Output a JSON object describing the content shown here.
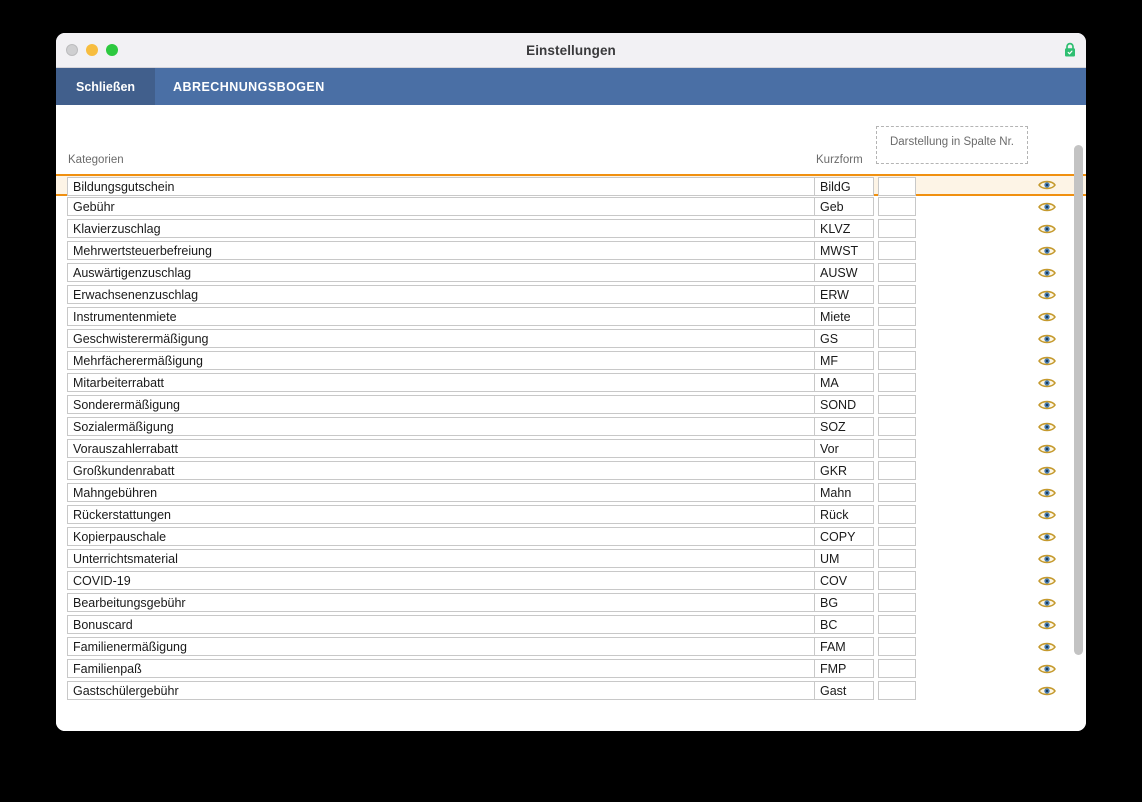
{
  "window": {
    "title": "Einstellungen",
    "traffic_lights": {
      "close": "close-button",
      "minimize": "minimize-button",
      "maximize": "maximize-button"
    },
    "lock_icon": "lock-icon",
    "lock_color": "#2fbf71"
  },
  "toolbar": {
    "close_label": "Schließen",
    "tab_label": "ABRECHNUNGSBOGEN",
    "background": "#4a6fa5",
    "close_background": "#415f8c"
  },
  "headers": {
    "kategorien": "Kategorien",
    "kurzform": "Kurzform",
    "spalte_group": "Darstellung in Spalte Nr."
  },
  "selection": {
    "selected_index": 0,
    "highlight_color": "#f09010",
    "highlight_background": "#fdf4e6"
  },
  "icons": {
    "eye": "eye-icon",
    "eye_outline_color": "#c59a2e",
    "eye_iris_color": "#4a7fb5"
  },
  "rows": [
    {
      "kategorie": "Bildungsgutschein",
      "kurzform": "BildG",
      "spalte": ""
    },
    {
      "kategorie": "Gebühr",
      "kurzform": "Geb",
      "spalte": ""
    },
    {
      "kategorie": "Klavierzuschlag",
      "kurzform": "KLVZ",
      "spalte": ""
    },
    {
      "kategorie": "Mehrwertsteuerbefreiung",
      "kurzform": "MWST",
      "spalte": ""
    },
    {
      "kategorie": "Auswärtigenzuschlag",
      "kurzform": "AUSW",
      "spalte": ""
    },
    {
      "kategorie": "Erwachsenenzuschlag",
      "kurzform": "ERW",
      "spalte": ""
    },
    {
      "kategorie": "Instrumentenmiete",
      "kurzform": "Miete",
      "spalte": ""
    },
    {
      "kategorie": "Geschwisterermäßigung",
      "kurzform": "GS",
      "spalte": ""
    },
    {
      "kategorie": "Mehrfächerermäßigung",
      "kurzform": "MF",
      "spalte": ""
    },
    {
      "kategorie": "Mitarbeiterrabatt",
      "kurzform": "MA",
      "spalte": ""
    },
    {
      "kategorie": "Sonderermäßigung",
      "kurzform": "SOND",
      "spalte": ""
    },
    {
      "kategorie": "Sozialermäßigung",
      "kurzform": "SOZ",
      "spalte": ""
    },
    {
      "kategorie": "Vorauszahlerrabatt",
      "kurzform": "Vor",
      "spalte": ""
    },
    {
      "kategorie": "Großkundenrabatt",
      "kurzform": "GKR",
      "spalte": ""
    },
    {
      "kategorie": "Mahngebühren",
      "kurzform": "Mahn",
      "spalte": ""
    },
    {
      "kategorie": "Rückerstattungen",
      "kurzform": "Rück",
      "spalte": ""
    },
    {
      "kategorie": "Kopierpauschale",
      "kurzform": "COPY",
      "spalte": ""
    },
    {
      "kategorie": "Unterrichtsmaterial",
      "kurzform": "UM",
      "spalte": ""
    },
    {
      "kategorie": "COVID-19",
      "kurzform": "COV",
      "spalte": ""
    },
    {
      "kategorie": "Bearbeitungsgebühr",
      "kurzform": "BG",
      "spalte": ""
    },
    {
      "kategorie": "Bonuscard",
      "kurzform": "BC",
      "spalte": ""
    },
    {
      "kategorie": "Familienermäßigung",
      "kurzform": "FAM",
      "spalte": ""
    },
    {
      "kategorie": "Familienpaß",
      "kurzform": "FMP",
      "spalte": ""
    },
    {
      "kategorie": "Gastschülergebühr",
      "kurzform": "Gast",
      "spalte": ""
    }
  ],
  "scrollbar": {
    "name": "vertical-scrollbar"
  }
}
